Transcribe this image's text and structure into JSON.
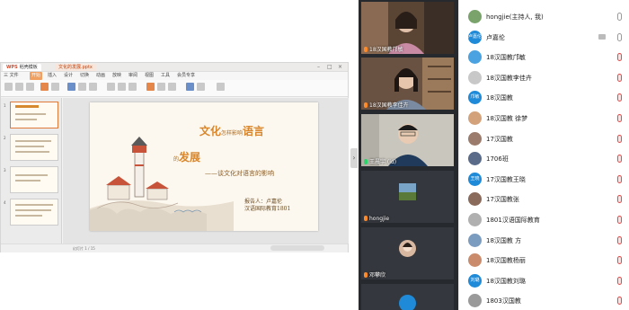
{
  "share": {
    "wps": {
      "tab1": "WPS",
      "tab1_name": "稻壳模板",
      "tab2": "文化的发展.pptx",
      "menu": [
        "三 文件",
        "开始",
        "插入",
        "设计",
        "切换",
        "动画",
        "放映",
        "审阅",
        "视图",
        "工具",
        "会员专享"
      ],
      "menu_active": "开始",
      "thumb_numbers": [
        "1",
        "2",
        "3",
        "4"
      ],
      "statusbar": "幻灯片 1 / 15",
      "slide": {
        "title_part1": "文化",
        "title_part1_small": "怎样影响",
        "title_part2": "语言",
        "title_part3_small": "的",
        "title_part4": "发展",
        "subtitle": "——谈文化对语言的影响",
        "author_line1": "报告人：卢嘉伦",
        "author_line2": "汉语国际教育1801"
      }
    },
    "collapse_icon": "chevron-right-icon"
  },
  "videos": [
    {
      "label": "18汉国教邝敏",
      "type": "cam",
      "mic": "muted"
    },
    {
      "label": "18汉国教李佳卉",
      "type": "cam",
      "mic": "muted"
    },
    {
      "label": "王晨宇 (id)",
      "type": "cam",
      "mic": "on"
    },
    {
      "label": "hongjie",
      "type": "off",
      "mic": "muted"
    },
    {
      "label": "邓攀欣",
      "type": "off",
      "mic": "muted"
    },
    {
      "label": "",
      "type": "off",
      "mic": "muted"
    }
  ],
  "participants": [
    {
      "name": "hongjie(主持人, 我)",
      "avatar_color": "#7aa36b",
      "avatar_text": "",
      "mic": "normal",
      "cam": false
    },
    {
      "name": "卢嘉伦",
      "avatar_color": "#1f8ad8",
      "avatar_text": "卢嘉伦",
      "mic": "normal",
      "cam": true
    },
    {
      "name": "18汉国教邝敏",
      "avatar_color": "#4aa3e0",
      "avatar_text": "",
      "mic": "red",
      "cam": false
    },
    {
      "name": "18汉国教李佳卉",
      "avatar_color": "#c8c8c8",
      "avatar_text": "",
      "mic": "red",
      "cam": false
    },
    {
      "name": "18汉国教",
      "avatar_color": "#1f8ad8",
      "avatar_text": "邝敏",
      "mic": "red",
      "cam": false
    },
    {
      "name": "18汉国教 徐梦",
      "avatar_color": "#d3a27a",
      "avatar_text": "",
      "mic": "red",
      "cam": false
    },
    {
      "name": "17汉国教",
      "avatar_color": "#9b7b6b",
      "avatar_text": "",
      "mic": "red",
      "cam": false
    },
    {
      "name": "1706班",
      "avatar_color": "#5a6b8a",
      "avatar_text": "",
      "mic": "red",
      "cam": false
    },
    {
      "name": "17汉国教王晓",
      "avatar_color": "#1f8ad8",
      "avatar_text": "王晓",
      "mic": "red",
      "cam": false
    },
    {
      "name": "17汉国教张",
      "avatar_color": "#8a6a5a",
      "avatar_text": "",
      "mic": "red",
      "cam": false
    },
    {
      "name": "1801汉语国际教育",
      "avatar_color": "#b0b0b0",
      "avatar_text": "",
      "mic": "red",
      "cam": false
    },
    {
      "name": "18汉国教 方",
      "avatar_color": "#7c9cbf",
      "avatar_text": "",
      "mic": "red",
      "cam": false
    },
    {
      "name": "18汉国教杨丽",
      "avatar_color": "#c98b6b",
      "avatar_text": "",
      "mic": "red",
      "cam": false
    },
    {
      "name": "18汉国教刘璐",
      "avatar_color": "#1f8ad8",
      "avatar_text": "刘璐",
      "mic": "red",
      "cam": false
    },
    {
      "name": "1803汉国教",
      "avatar_color": "#9a9a9a",
      "avatar_text": "",
      "mic": "red",
      "cam": false
    }
  ]
}
